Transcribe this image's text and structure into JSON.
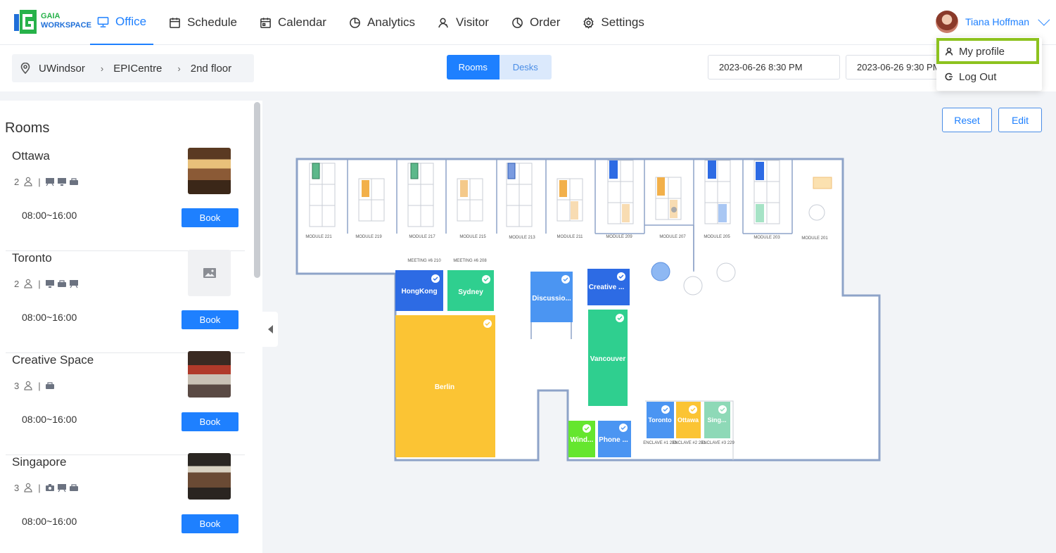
{
  "logo": {
    "line1": "GAIA",
    "line2": "WORKSPACE"
  },
  "nav": [
    {
      "label": "Office",
      "icon": "monitor-icon",
      "active": true
    },
    {
      "label": "Schedule",
      "icon": "calendar-icon"
    },
    {
      "label": "Calendar",
      "icon": "calendar-grid-icon"
    },
    {
      "label": "Analytics",
      "icon": "pie-chart-icon"
    },
    {
      "label": "Visitor",
      "icon": "visitor-icon"
    },
    {
      "label": "Order",
      "icon": "order-icon"
    },
    {
      "label": "Settings",
      "icon": "gear-icon"
    }
  ],
  "user": {
    "name": "Tiana Hoffman"
  },
  "dropdown": {
    "my_profile": "My profile",
    "log_out": "Log Out"
  },
  "breadcrumb": {
    "site": "UWindsor",
    "building": "EPICentre",
    "floor": "2nd floor"
  },
  "view_toggle": {
    "rooms": "Rooms",
    "desks": "Desks",
    "selected": "Rooms"
  },
  "dates": {
    "start": "2023-06-26 8:30 PM",
    "end": "2023-06-26 9:30 PM"
  },
  "buttons": {
    "reset": "Reset",
    "edit": "Edit"
  },
  "rooms_panel": {
    "title": "Rooms",
    "book_label": "Book",
    "rooms": [
      {
        "name": "Ottawa",
        "capacity": "2",
        "time": "08:00~16:00"
      },
      {
        "name": "Toronto",
        "capacity": "2",
        "time": "08:00~16:00"
      },
      {
        "name": "Creative Space",
        "capacity": "3",
        "time": "08:00~16:00"
      },
      {
        "name": "Singapore",
        "capacity": "3",
        "time": "08:00~16:00"
      }
    ]
  },
  "floorplan": {
    "modules": [
      "MODULE 221",
      "MODULE 219",
      "MODULE 217",
      "MODULE 215",
      "MODULE 213",
      "MODULE 211",
      "MODULE 209",
      "MODULE 207",
      "MODULE 205",
      "MODULE 203",
      "MODULE 201"
    ],
    "meeting_labels": {
      "m210": "MEETING #6 210",
      "m208": "MEETING #6 208"
    },
    "rooms": {
      "hongkong": "HongKong",
      "sydney": "Sydney",
      "discussion": "Discussio...",
      "creative": "Creative ...",
      "berlin": "Berlin",
      "vancouver": "Vancouver",
      "windsor": "Wind...",
      "phone": "Phone ...",
      "toronto": "Toronto",
      "ottawa": "Ottawa",
      "singapore": "Sing..."
    },
    "enclaves": {
      "e233": "ENCLAVE #1 233",
      "e231": "ENCLAVE #2 231",
      "e229": "ENCLAVE #3 229"
    },
    "colors": {
      "blue": "#2d6be4",
      "green": "#2fcf8f",
      "yellow": "#fbc434",
      "lime": "#65e62e",
      "lightblue": "#4b95f2"
    }
  }
}
